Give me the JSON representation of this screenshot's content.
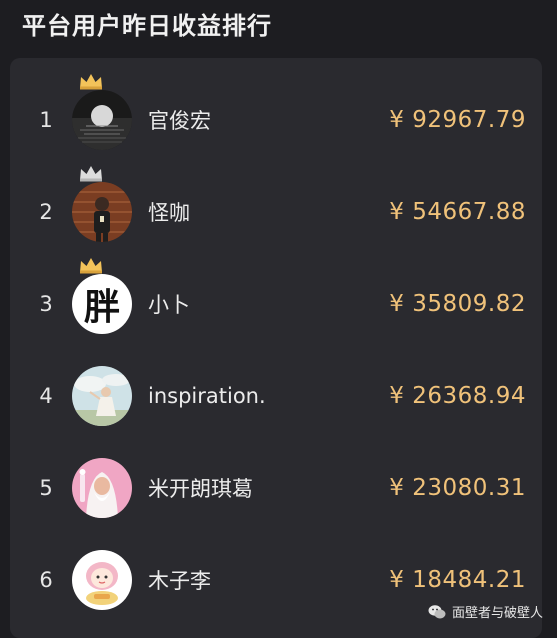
{
  "header": {
    "title": "平台用户昨日收益排行"
  },
  "ranking": [
    {
      "rank": "1",
      "name": "官俊宏",
      "amount": "¥ 92967.79",
      "crown": "gold",
      "avatar": "moon-lake"
    },
    {
      "rank": "2",
      "name": "怪咖",
      "amount": "¥ 54667.88",
      "crown": "silver",
      "avatar": "person-brick-wall"
    },
    {
      "rank": "3",
      "name": "小卜",
      "amount": "¥ 35809.82",
      "crown": "gold",
      "avatar": "calligraphy-character",
      "avatar_text": "胖"
    },
    {
      "rank": "4",
      "name": "inspiration.",
      "amount": "¥ 26368.94",
      "crown": null,
      "avatar": "sky-person"
    },
    {
      "rank": "5",
      "name": "米开朗琪葛",
      "amount": "¥ 23080.31",
      "crown": null,
      "avatar": "wizard-pink"
    },
    {
      "rank": "6",
      "name": "木子李",
      "amount": "¥ 18484.21",
      "crown": null,
      "avatar": "cartoon-girl"
    }
  ],
  "watermark": {
    "text": "面壁者与破壁人",
    "icon": "wechat-icon"
  },
  "colors": {
    "background": "#1d1d21",
    "card": "#2a2a2f",
    "amount": "#f0c27a",
    "crown_gold": "#f3c35a",
    "crown_silver": "#dcdcdc"
  }
}
